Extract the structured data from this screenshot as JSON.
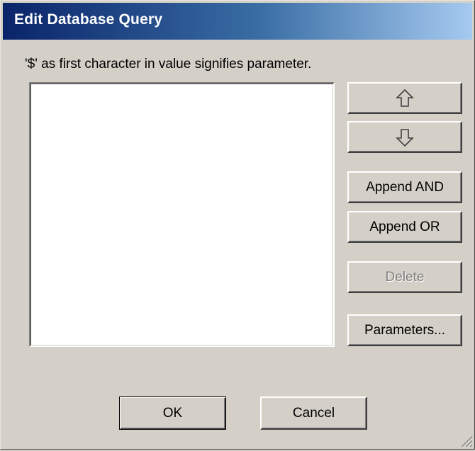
{
  "dialog": {
    "title": "Edit Database Query",
    "hint": "'$' as first character in value signifies parameter."
  },
  "buttons": {
    "move_up_icon": "arrow-up-icon",
    "move_down_icon": "arrow-down-icon",
    "append_and": "Append AND",
    "append_or": "Append OR",
    "delete": "Delete",
    "parameters": "Parameters...",
    "ok": "OK",
    "cancel": "Cancel"
  },
  "conditions": [],
  "colors": {
    "title_gradient_start": "#0a246a",
    "title_gradient_end": "#a6caf0",
    "face": "#d4d0c8",
    "disabled_text": "#808080"
  }
}
